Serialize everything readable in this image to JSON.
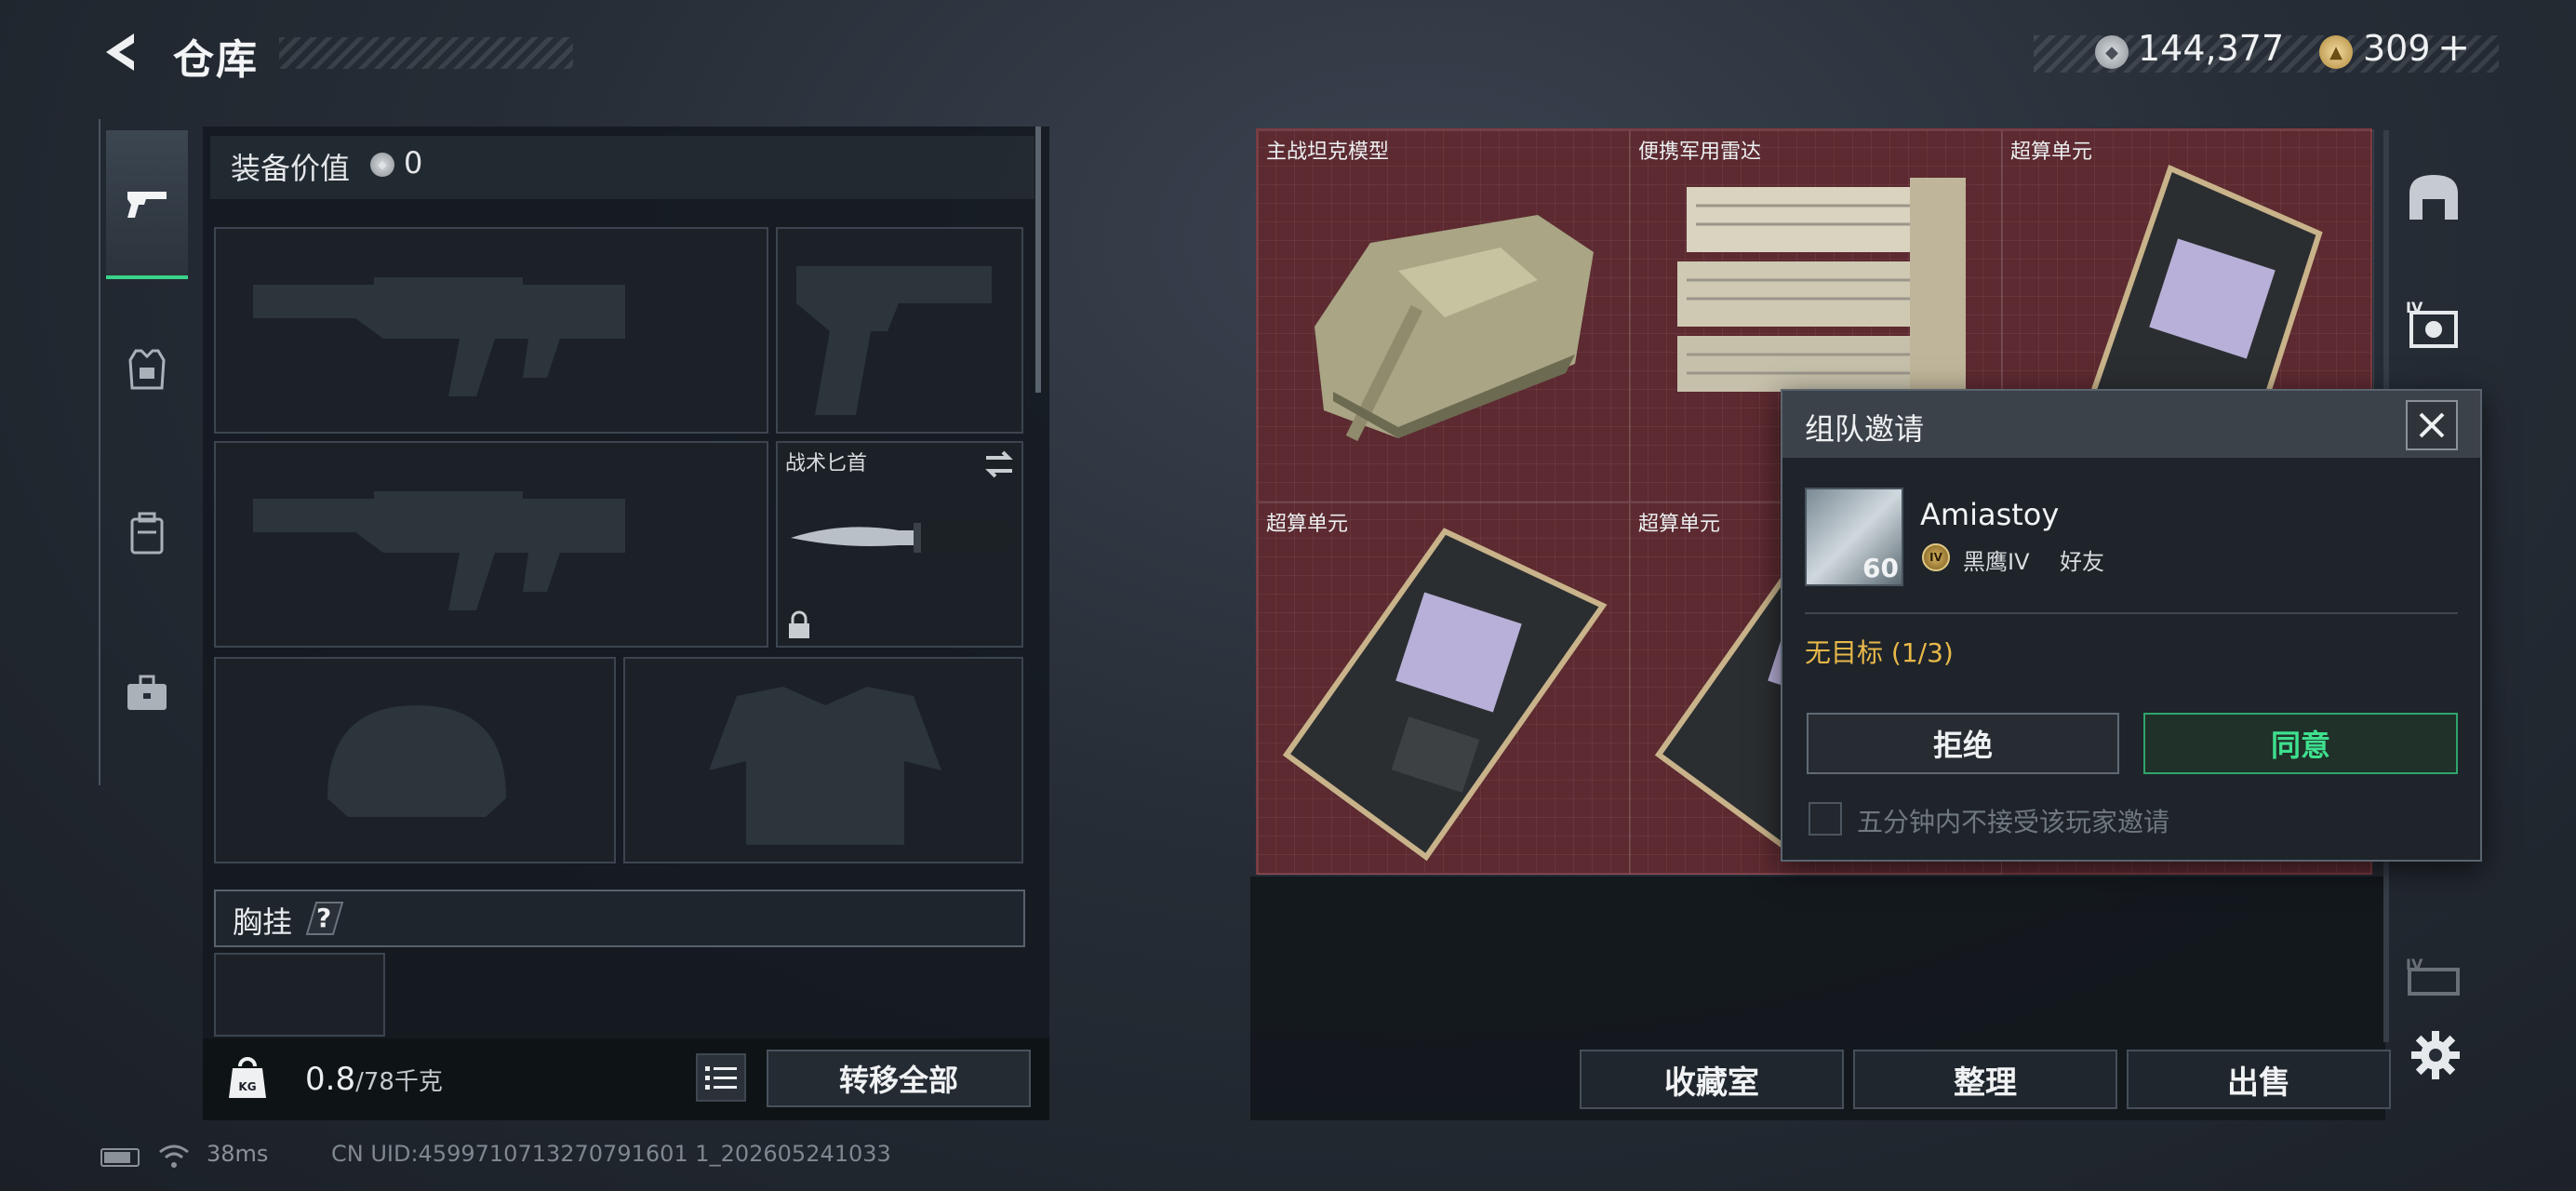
{
  "header": {
    "title": "仓库"
  },
  "currency": {
    "silver": "144,377",
    "gold": "309",
    "plus": "+"
  },
  "equipment": {
    "value_label": "装备价值",
    "value": "0",
    "knife_label": "战术匕首",
    "chest_label": "胸挂",
    "help": "?"
  },
  "capacity": {
    "current": "0.8",
    "max": "/78千克"
  },
  "buttons": {
    "transfer_all": "转移全部",
    "collection": "收藏室",
    "organize": "整理",
    "sell": "出售"
  },
  "storage": {
    "items": [
      {
        "label": "主战坦克模型"
      },
      {
        "label": "便携军用雷达"
      },
      {
        "label": "超算单元"
      },
      {
        "label": "超算单元"
      },
      {
        "label": "超算单元"
      }
    ]
  },
  "status": {
    "ping": "38ms",
    "uid": "CN UID:4599710713270791601 1_202605241033"
  },
  "dialog": {
    "title": "组队邀请",
    "player_name": "Amiastoy",
    "player_level": "60",
    "rank_badge": "IV",
    "rank": "黑鹰IV",
    "relation": "好友",
    "target_status": "无目标 (1/3)",
    "reject": "拒绝",
    "accept": "同意",
    "mute_label": "五分钟内不接受该玩家邀请"
  },
  "right_tabs": {
    "tab2_badge": "IV",
    "tab4_badge": "IV"
  },
  "colors": {
    "accent_green": "#3ee08e",
    "gold_text": "#e8b84a",
    "grid_red": "#5c2a30"
  }
}
